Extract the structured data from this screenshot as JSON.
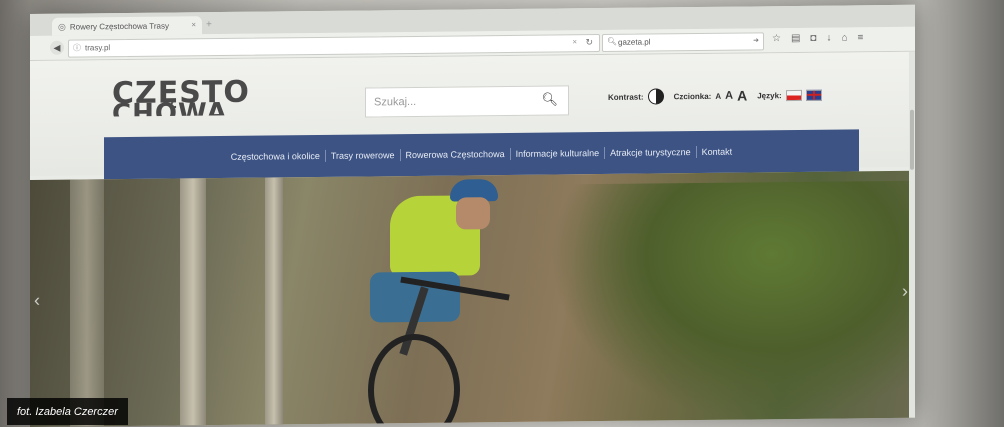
{
  "browser": {
    "tab_title": "Rowery Częstochowa Trasy",
    "tab_close": "×",
    "new_tab": "+",
    "url": "trasy.pl",
    "search_value": "gazeta.pl"
  },
  "site": {
    "logo_line1": "CZĘSTO",
    "logo_line2": "CHOWA",
    "search_placeholder": "Szukaj...",
    "contrast_label": "Kontrast:",
    "font_label": "Czcionka:",
    "font_small": "A",
    "font_mid": "A",
    "font_big": "A",
    "language_label": "Język:"
  },
  "menu": [
    {
      "label": "Częstochowa i okolice"
    },
    {
      "label": "Trasy rowerowe"
    },
    {
      "label": "Rowerowa Częstochowa"
    },
    {
      "label": "Informacje kulturalne"
    },
    {
      "label": "Atrakcje turystyczne"
    },
    {
      "label": "Kontakt"
    }
  ],
  "photo_credit": "fot. Izabela Czerczer",
  "colors": {
    "menu_bg": "#3c5384",
    "jersey": "#b7d33a"
  }
}
